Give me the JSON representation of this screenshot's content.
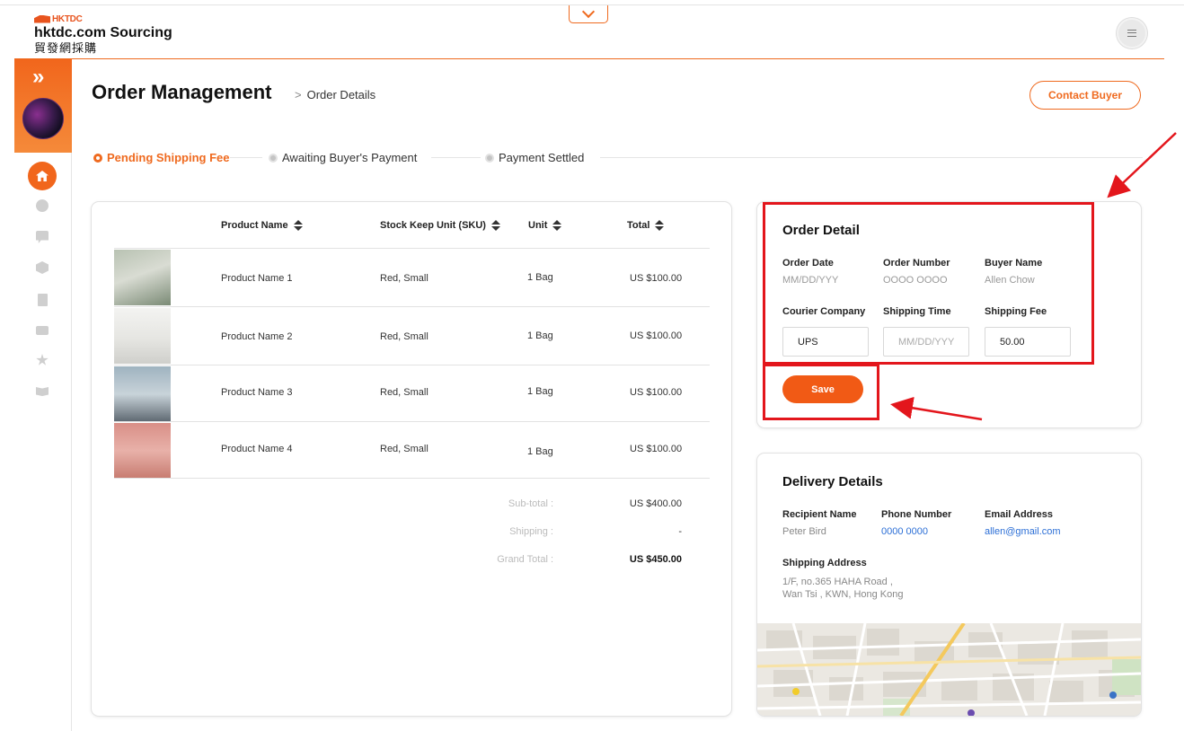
{
  "header": {
    "brand_small": "HKTDC",
    "brand_title": "hktdc.com Sourcing",
    "brand_subtitle": "貿發網採購"
  },
  "sidebar": {
    "expand_glyph": "»",
    "items": [
      {
        "icon": "home-icon",
        "active": true
      },
      {
        "icon": "user-icon"
      },
      {
        "icon": "chat-icon"
      },
      {
        "icon": "box-icon"
      },
      {
        "icon": "document-icon"
      },
      {
        "icon": "cash-icon"
      },
      {
        "icon": "star-icon"
      },
      {
        "icon": "book-icon"
      }
    ]
  },
  "page": {
    "title": "Order Management",
    "breadcrumb_sep": ">",
    "breadcrumb": "Order Details",
    "contact_label": "Contact Buyer"
  },
  "stepper": {
    "steps": [
      {
        "label": "Pending Shipping Fee",
        "active": true
      },
      {
        "label": "Awaiting Buyer's Payment",
        "active": false
      },
      {
        "label": "Payment Settled",
        "active": false
      }
    ]
  },
  "products": {
    "columns": [
      "Product Name",
      "Stock Keep Unit (SKU)",
      "Unit",
      "Total"
    ],
    "rows": [
      {
        "name": "Product Name 1",
        "sku": "Red, Small",
        "unit": "1 Bag",
        "total": "US $100.00"
      },
      {
        "name": "Product Name 2",
        "sku": "Red, Small",
        "unit": "1 Bag",
        "total": "US $100.00"
      },
      {
        "name": "Product Name 3",
        "sku": "Red, Small",
        "unit": "1 Bag",
        "total": "US $100.00"
      },
      {
        "name": "Product Name 4",
        "sku": "Red, Small",
        "unit": "1 Bag",
        "total": "US $100.00"
      }
    ],
    "subtotal_label": "Sub-total :",
    "subtotal": "US $400.00",
    "shipping_label": "Shipping :",
    "shipping": "-",
    "grand_total_label": "Grand Total :",
    "grand_total": "US $450.00"
  },
  "order_detail": {
    "title": "Order Detail",
    "order_date_label": "Order Date",
    "order_date": "MM/DD/YYY",
    "order_number_label": "Order Number",
    "order_number": "OOOO OOOO",
    "buyer_name_label": "Buyer Name",
    "buyer_name": "Allen Chow",
    "courier_label": "Courier Company",
    "courier_value": "UPS",
    "shipping_time_label": "Shipping Time",
    "shipping_time_placeholder": "MM/DD/YYYY",
    "shipping_fee_label": "Shipping Fee",
    "shipping_fee_value": "50.00",
    "save_label": "Save"
  },
  "delivery": {
    "title": "Delivery Details",
    "recipient_label": "Recipient Name",
    "recipient": "Peter Bird",
    "phone_label": "Phone Number",
    "phone": "0000 0000",
    "email_label": "Email Address",
    "email": "allen@gmail.com",
    "address_label": "Shipping Address",
    "address_line1": "1/F, no.365 HAHA Road ,",
    "address_line2": "Wan Tsi , KWN, Hong Kong"
  },
  "colors": {
    "accent": "#ef6a1f",
    "save": "#f15a15",
    "annotation": "#e3161c",
    "link": "#2c6fd6"
  }
}
